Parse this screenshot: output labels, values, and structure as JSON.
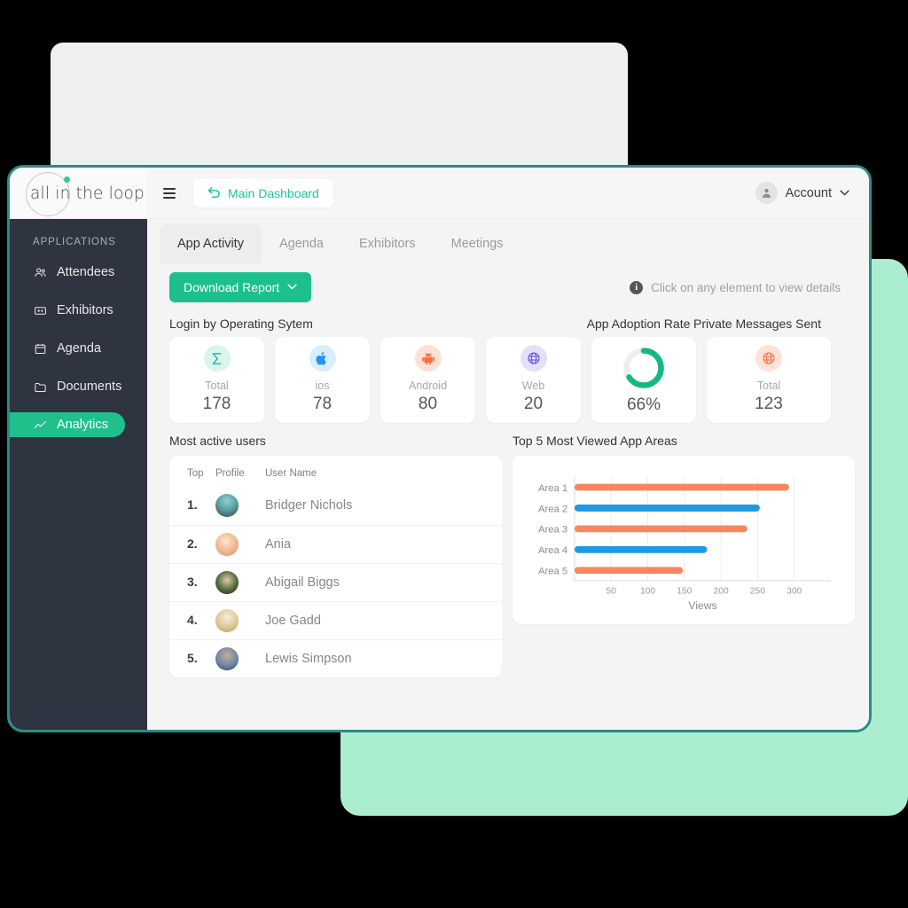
{
  "brand": {
    "name": "all in the loop",
    "part_a": "all in",
    "part_b": "the loop"
  },
  "topbar": {
    "menu_icon": "hamburger-icon",
    "dashboard_label": "Main Dashboard",
    "back_icon": "back-arrow-icon",
    "account_label": "Account",
    "account_caret": "⌄",
    "avatar_icon": "person-icon"
  },
  "sidebar": {
    "section_label": "APPLICATIONS",
    "items": [
      {
        "label": "Attendees",
        "icon": "people-icon",
        "active": false
      },
      {
        "label": "Exhibitors",
        "icon": "ticket-icon",
        "active": false
      },
      {
        "label": "Agenda",
        "icon": "calendar-icon",
        "active": false
      },
      {
        "label": "Documents",
        "icon": "folder-icon",
        "active": false
      },
      {
        "label": "Analytics",
        "icon": "chart-line-icon",
        "active": true
      }
    ]
  },
  "tabs": [
    {
      "label": "App Activity",
      "active": true
    },
    {
      "label": "Agenda",
      "active": false
    },
    {
      "label": "Exhibitors",
      "active": false
    },
    {
      "label": "Meetings",
      "active": false
    }
  ],
  "toolbar": {
    "download_label": "Download Report",
    "download_caret": "⌄",
    "hint_text": "Click on any element to view details",
    "info_icon": "info-icon"
  },
  "sections": {
    "os_title": "Login by Operating Sytem",
    "adoption_title": "App Adoption Rate",
    "messages_title": "Private Messages Sent",
    "users_title": "Most active users",
    "areas_title": "Top 5 Most Viewed App Areas"
  },
  "os_stats": [
    {
      "label": "Total",
      "value": "178",
      "icon": "sigma-icon",
      "glyph": "Σ",
      "fg": "#25b79a",
      "bg": "#d9f5ec"
    },
    {
      "label": "ios",
      "value": "78",
      "icon": "apple-icon",
      "glyph": "",
      "fg": "#2196f3",
      "bg": "#d9eefc"
    },
    {
      "label": "Android",
      "value": "80",
      "icon": "android-icon",
      "glyph": "●",
      "fg": "#fc6c3f",
      "bg": "#fde1d7"
    },
    {
      "label": "Web",
      "value": "20",
      "icon": "globe-icon",
      "glyph": "⊕",
      "fg": "#5b4ce0",
      "bg": "#e2e0fb"
    }
  ],
  "adoption": {
    "percent_label": "66%",
    "percent": 66,
    "color": "#14b982",
    "track": "#ededed"
  },
  "messages": {
    "label": "Total",
    "value": "123",
    "icon": "globe-icon",
    "glyph": "⊕",
    "fg": "#fc6c3f",
    "bg": "#fde2da"
  },
  "users_table": {
    "headers": [
      "Top",
      "Profile",
      "User Name"
    ],
    "rows": [
      {
        "rank": "1.",
        "name": "Bridger Nichols",
        "avatar_icon": "user-avatar",
        "c1": "#7dc3c3",
        "c2": "#31414a"
      },
      {
        "rank": "2.",
        "name": "Ania",
        "avatar_icon": "user-avatar",
        "c1": "#f6d6c2",
        "c2": "#d98f6a"
      },
      {
        "rank": "3.",
        "name": "Abigail Biggs",
        "avatar_icon": "user-avatar",
        "c1": "#3f5a32",
        "c2": "#1d2a18"
      },
      {
        "rank": "4.",
        "name": "Joe Gadd",
        "avatar_icon": "user-avatar",
        "c1": "#efe3c6",
        "c2": "#c4a46b"
      },
      {
        "rank": "5.",
        "name": "Lewis Simpson",
        "avatar_icon": "user-avatar",
        "c1": "#6d87a8",
        "c2": "#2d3a4c"
      }
    ]
  },
  "chart_data": {
    "type": "bar",
    "orientation": "horizontal",
    "title": "Top 5 Most Viewed App Areas",
    "xlabel": "Views",
    "ylabel": "",
    "categories": [
      "Area 1",
      "Area 2",
      "Area 3",
      "Area 4",
      "Area 5"
    ],
    "values": [
      293,
      253,
      236,
      181,
      148
    ],
    "colors": [
      "#f98660",
      "#1e9ae0",
      "#f98660",
      "#1e9ae0",
      "#f98660"
    ],
    "xlim": [
      0,
      350
    ],
    "xticks": [
      50,
      100,
      150,
      200,
      250,
      300
    ],
    "grid": true,
    "legend": null
  },
  "theme": {
    "accent_green": "#1dc08d",
    "window_border": "#2c8c88",
    "sidebar_bg": "#2e3440",
    "mint": "#abeecf",
    "page_bg": "#f4f4f5"
  }
}
